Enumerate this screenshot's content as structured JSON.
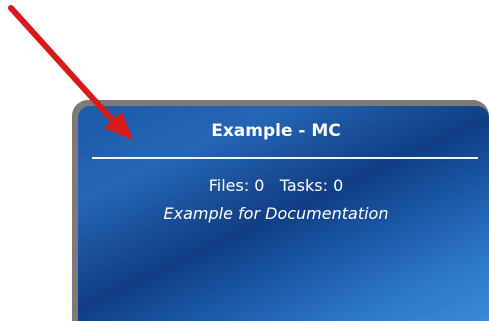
{
  "card": {
    "title": "Example - MC",
    "counts": "Files: 0   Tasks: 0",
    "description": "Example for Documentation"
  },
  "colors": {
    "arrow": "#d81a1a",
    "card_border": "#7b7b7b",
    "card_blue_dark": "#0f3e84",
    "card_blue_light": "#3b89d5"
  },
  "icons": {
    "pointer": "red-arrow-icon"
  }
}
